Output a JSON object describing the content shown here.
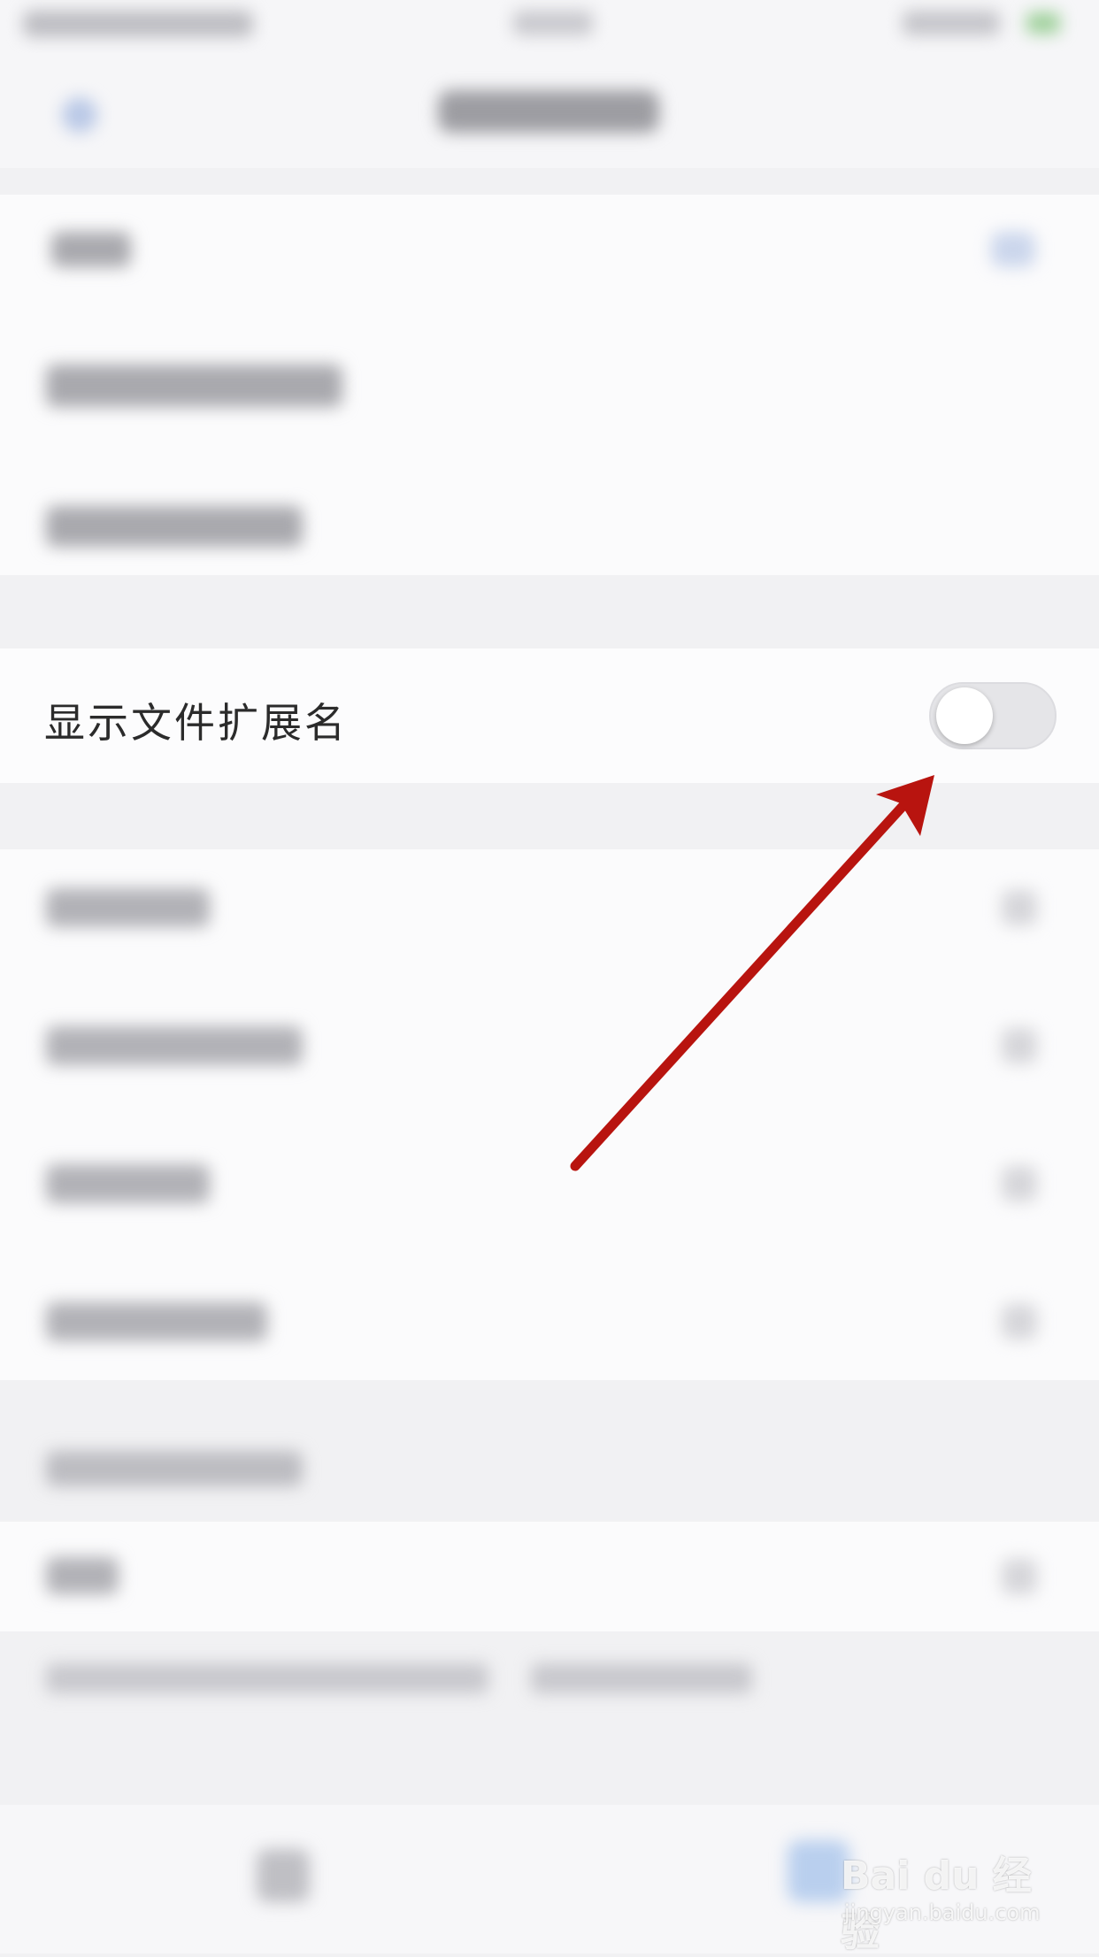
{
  "settings": {
    "show_extension_label": "显示文件扩展名",
    "show_extension_toggle": "off"
  },
  "watermark": {
    "brand": "Bai du 经验",
    "url": "jingyan.baidu.com"
  },
  "colors": {
    "annotation_arrow": "#b8140f",
    "toggle_off_track": "#e5e5e8"
  },
  "icons": {
    "back": "chevron-left-icon",
    "tab_left": "folder-icon",
    "tab_right": "profile-icon"
  }
}
